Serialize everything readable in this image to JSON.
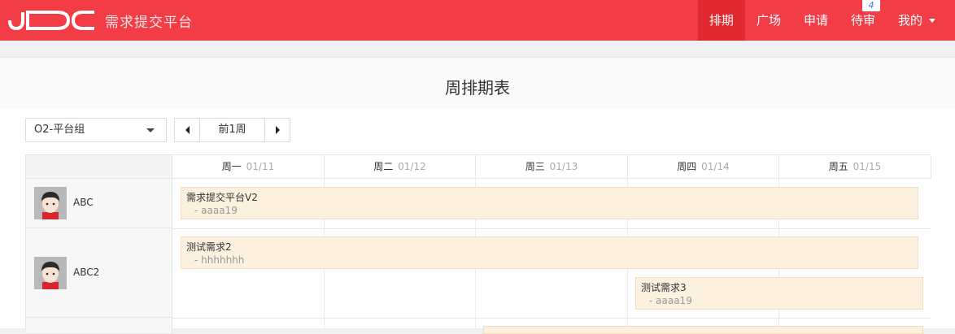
{
  "app": {
    "logo_text": "JDC",
    "brand": "需求提交平台"
  },
  "nav": {
    "items": [
      {
        "label": "排期"
      },
      {
        "label": "广场"
      },
      {
        "label": "申请"
      },
      {
        "label": "待审",
        "badge": "4"
      },
      {
        "label": "我的"
      }
    ]
  },
  "page": {
    "title": "周排期表"
  },
  "filters": {
    "group_selected": "O2-平台组",
    "week_label": "前1周"
  },
  "schedule": {
    "days": [
      {
        "name": "周一",
        "date": "01/11"
      },
      {
        "name": "周二",
        "date": "01/12"
      },
      {
        "name": "周三",
        "date": "01/13"
      },
      {
        "name": "周四",
        "date": "01/14"
      },
      {
        "name": "周五",
        "date": "01/15"
      }
    ],
    "rows": [
      {
        "person": "ABC",
        "tasks": [
          {
            "title": "需求提交平台V2",
            "owner": "- aaaa19"
          }
        ]
      },
      {
        "person": "ABC2",
        "tasks": [
          {
            "title": "测试需求2",
            "owner": "- hhhhhhh"
          },
          {
            "title": "测试需求3",
            "owner": "- aaaa19"
          }
        ]
      }
    ]
  },
  "colors": {
    "topbar": "#f23d47",
    "topbar_active": "#e22831",
    "task_bg": "#fcf0de",
    "task_border": "#f2ddbc"
  }
}
